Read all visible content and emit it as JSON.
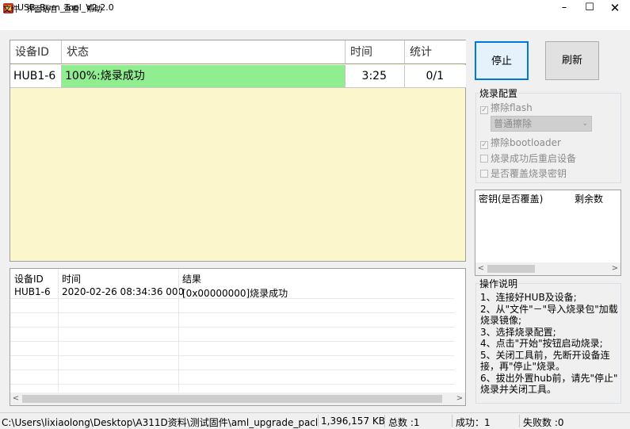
{
  "window": {
    "title": "USB_Burn_Tool_V2.2.0",
    "minimize": "–",
    "maximize": "☐",
    "close": "✕"
  },
  "menu": [
    "文件",
    "界面语言",
    "查看",
    "帮助"
  ],
  "grid": {
    "headers": [
      "设备ID",
      "状态",
      "时间",
      "统计"
    ],
    "row": {
      "device_id": "HUB1-6",
      "status": "100%:烧录成功",
      "time": "3:25",
      "stats": "0/1",
      "progress": 1.0
    },
    "colors": {
      "progress": "#90ee90",
      "background": "#fbf6cc"
    }
  },
  "log": {
    "headers": [
      "设备ID",
      "时间",
      "结果"
    ],
    "rows": [
      {
        "device_id": "HUB1-6",
        "time": "2020-02-26 08:34:36 000",
        "result": "[0x00000000]烧录成功"
      }
    ]
  },
  "buttons": {
    "stop": "停止",
    "refresh": "刷新"
  },
  "burn_config": {
    "title": "烧录配置",
    "erase_flash": {
      "label": "擦除flash",
      "checked": true,
      "enabled": false
    },
    "erase_mode": "普通擦除",
    "erase_bootloader": {
      "label": "擦除bootloader",
      "checked": true,
      "enabled": false
    },
    "reboot_after": {
      "label": "烧录成功后重启设备",
      "checked": false,
      "enabled": false
    },
    "overwrite_key": {
      "label": "是否覆盖烧录密钥",
      "checked": false,
      "enabled": false
    }
  },
  "key_panel": {
    "col_key": "密钥(是否覆盖)",
    "col_remaining": "剩余数"
  },
  "instructions": {
    "title": "操作说明",
    "lines": [
      "1、连接好HUB及设备;",
      "2、从\"文件\"－\"导入烧录包\"加载",
      "烧录镜像;",
      "3、选择烧录配置;",
      "4、点击\"开始\"按钮启动烧录;",
      "5、关闭工具前，先断开设备连",
      "接，再\"停止\"烧录。",
      "6、拔出外置hub前，请先\"停止\"",
      "烧录并关闭工具。"
    ]
  },
  "status_bar": {
    "path": "C:\\Users\\lixiaolong\\Desktop\\A311D资料\\测试固件\\aml_upgrade_package_",
    "size": "1,396,157 KB",
    "total": "总数 :1",
    "success": "成功：1",
    "fail": "失败数 :0"
  }
}
